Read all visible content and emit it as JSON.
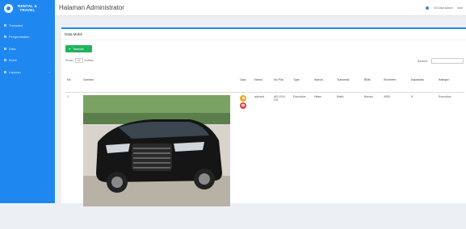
{
  "sidebar": {
    "brand_line1": "RENTAL &",
    "brand_line2": "TRAVEL",
    "items": [
      {
        "label": "Transaksi"
      },
      {
        "label": "Pengembalian"
      },
      {
        "label": "Data"
      },
      {
        "label": "Mobil"
      },
      {
        "label": "Laporan"
      }
    ]
  },
  "topbar": {
    "title": "Halaman Administrator",
    "user": "Sri Utari Admin",
    "logout": "sect"
  },
  "panel": {
    "title": "Data Mobil",
    "add_button": "Tambah",
    "show_label": "Show",
    "entries_value": "10",
    "entries_label": "entries",
    "search_label": "Search:"
  },
  "table": {
    "headers": [
      "No",
      "Gambar",
      "Opsi",
      "Nama",
      "No Plat",
      "Type",
      "Warna",
      "Transmisi",
      "BBM",
      "Kilometer",
      "Kapasitas",
      "Kategori"
    ],
    "rows": [
      {
        "no": "1",
        "nama": "alphard",
        "plat": "AB 1024 DG",
        "type": "Executive",
        "warna": "Hitam",
        "transmisi": "Matic",
        "bbm": "Bensin",
        "kilometer": "4000",
        "kapasitas": "6",
        "kategori": "Executive"
      }
    ]
  }
}
